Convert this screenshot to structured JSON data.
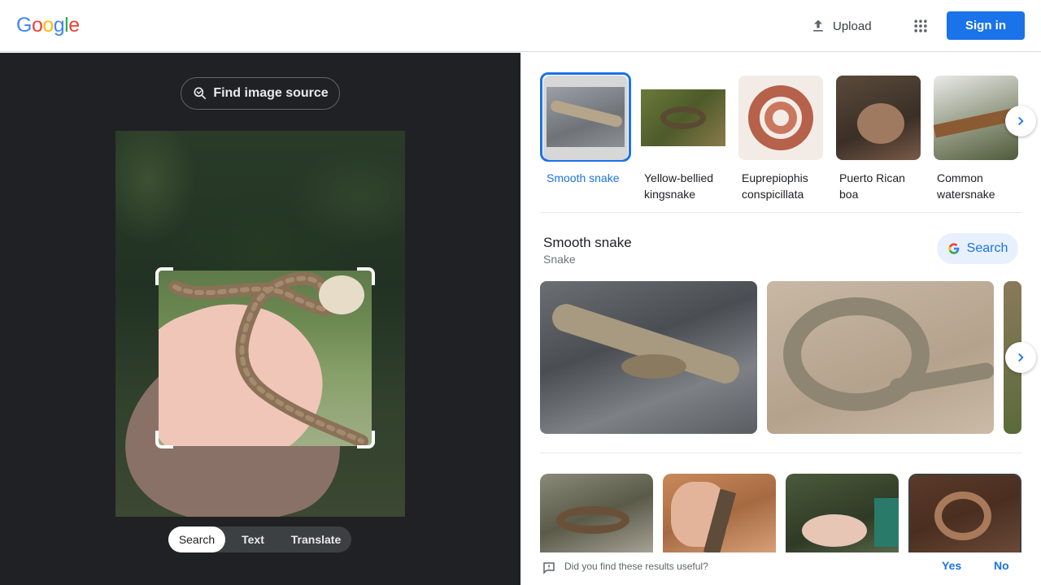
{
  "header": {
    "logo_letters": [
      "G",
      "o",
      "o",
      "g",
      "l",
      "e"
    ],
    "upload_label": "Upload",
    "sign_in_label": "Sign in"
  },
  "left_panel": {
    "find_source_label": "Find image source",
    "modes": [
      {
        "label": "Search",
        "active": true
      },
      {
        "label": "Text",
        "active": false
      },
      {
        "label": "Translate",
        "active": false
      }
    ]
  },
  "candidates": [
    {
      "label": "Smooth snake",
      "selected": true
    },
    {
      "label": "Yellow-bellied kingsnake",
      "selected": false
    },
    {
      "label": "Eupreпiophis conspicillata",
      "selected": false
    },
    {
      "label": "Puerto Rican boa",
      "selected": false
    },
    {
      "label": "Common watersnake",
      "selected": false
    }
  ],
  "entity": {
    "title": "Smooth snake",
    "subtitle": "Snake",
    "search_label": "Search"
  },
  "feedback": {
    "question": "Did you find these results useful?",
    "yes": "Yes",
    "no": "No"
  },
  "colors": {
    "accent": "#1a73e8",
    "left_bg": "#202124"
  }
}
